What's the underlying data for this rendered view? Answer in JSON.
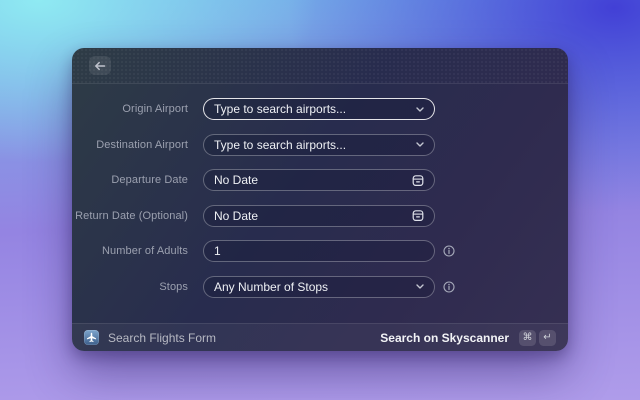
{
  "window": {
    "kind": "raycast-form",
    "back_button": {
      "icon": "arrow-left-icon"
    }
  },
  "form": {
    "fields": [
      {
        "label": "Origin Airport",
        "value": "Type to search airports...",
        "control": "select",
        "focused": true,
        "info": false
      },
      {
        "label": "Destination Airport",
        "value": "Type to search airports...",
        "control": "select",
        "focused": false,
        "info": false
      },
      {
        "label": "Departure Date",
        "value": "No Date",
        "control": "date",
        "focused": false,
        "info": false
      },
      {
        "label": "Return Date (Optional)",
        "value": "No Date",
        "control": "date",
        "focused": false,
        "info": false
      },
      {
        "label": "Number of Adults",
        "value": "1",
        "control": "text",
        "focused": false,
        "info": true
      },
      {
        "label": "Stops",
        "value": "Any Number of Stops",
        "control": "select",
        "focused": false,
        "info": true
      }
    ]
  },
  "footer": {
    "app_icon": "airplane-icon",
    "title": "Search Flights Form",
    "action_label": "Search on Skyscanner",
    "shortcuts": [
      "⌘",
      "↵"
    ]
  },
  "icons": {
    "arrow-left-icon": "←",
    "chevron-down-icon": "⌄",
    "calendar-icon": "calendar glyph",
    "info-icon": "ⓘ",
    "airplane-icon": "✈",
    "command-key": "⌘",
    "return-key": "↵"
  },
  "colors": {
    "bg_cyan": "#8feaf2",
    "bg_indigo": "#4240d6",
    "bg_purple": "#af9cea",
    "modal_top": "#2e3c46",
    "modal_bottom": "#363053",
    "field_border": "rgba(255,255,255,0.30)",
    "field_border_focused": "rgba(255,255,255,0.88)",
    "label_text": "#9ba0af",
    "value_text": "#eef0f4",
    "app_icon_blue": "#3d5f8c"
  }
}
